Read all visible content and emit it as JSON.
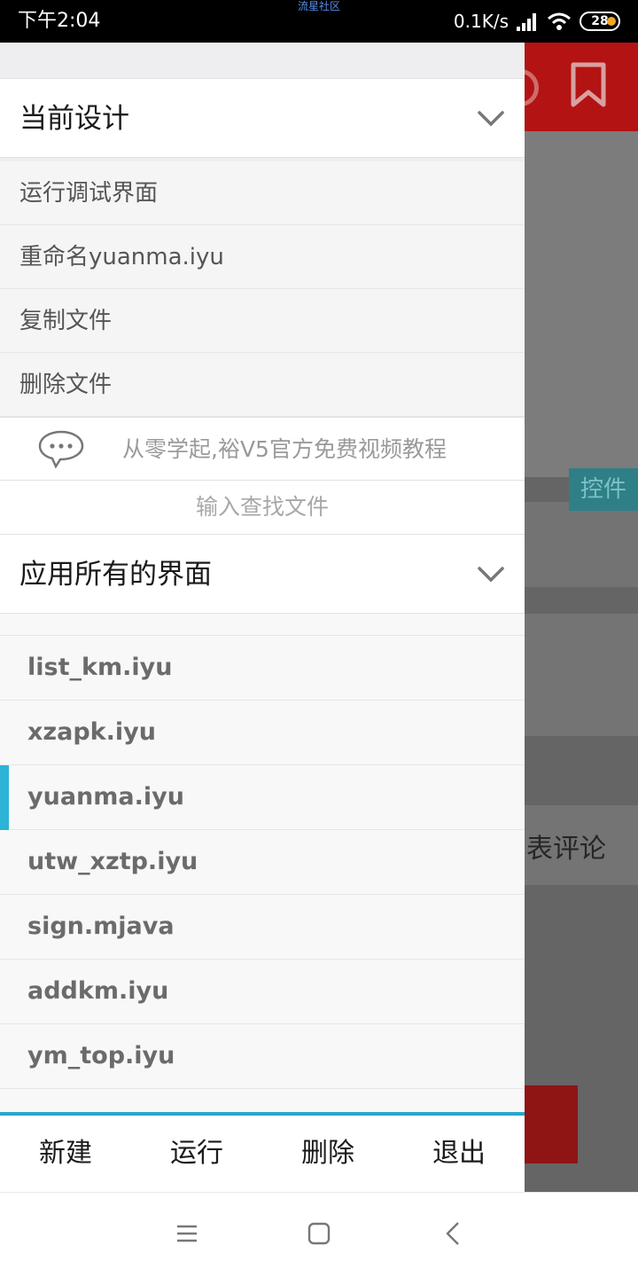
{
  "status_bar": {
    "time": "下午2:04",
    "center_text": "流星社区",
    "net_speed": "0.1K/s",
    "battery": "28"
  },
  "background": {
    "control_label": "控件",
    "comment_label": "表评论"
  },
  "drawer": {
    "current_design": {
      "title": "当前设计",
      "items": [
        "运行调试界面",
        "重命名yuanma.iyu",
        "复制文件",
        "删除文件"
      ]
    },
    "notice": {
      "text": "从零学起,裕V5官方免费视频教程",
      "icon": "chat-bubble-icon"
    },
    "search": {
      "placeholder": "输入查找文件"
    },
    "all_screens": {
      "title": "应用所有的界面",
      "files": [
        "list_km.iyu",
        "xzapk.iyu",
        "yuanma.iyu",
        "utw_xztp.iyu",
        "sign.mjava",
        "addkm.iyu",
        "ym_top.iyu"
      ],
      "selected": "yuanma.iyu"
    },
    "bottom_bar": {
      "new": "新建",
      "run": "运行",
      "delete": "删除",
      "exit": "退出"
    },
    "accent_color": "#2cb3d6"
  },
  "nav_bar": {
    "icons": [
      "menu-icon",
      "home-icon",
      "back-icon"
    ]
  }
}
